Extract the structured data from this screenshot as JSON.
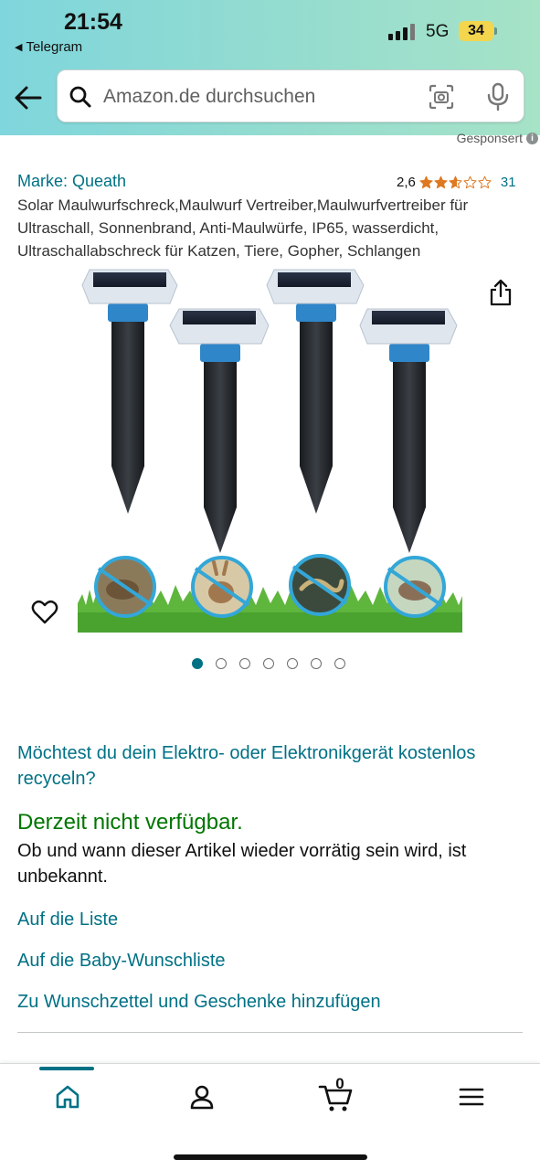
{
  "status_bar": {
    "time": "21:54",
    "back_app": "Telegram",
    "network": "5G",
    "battery": "34"
  },
  "search": {
    "placeholder": "Amazon.de durchsuchen"
  },
  "product": {
    "sponsored_label": "Gesponsert",
    "brand_label": "Marke: Queath",
    "rating_value": "2,6",
    "rating_stars": 2.6,
    "rating_count": "31",
    "title": "Solar Maulwurfschreck,Maulwurf Vertreiber,Maulwurfvertreiber für Ultraschall, Sonnenbrand, Anti-Maulwürfe, IP65, wasserdicht, Ultraschallabschreck für Katzen, Tiere, Gopher, Schlangen",
    "image_count": 7,
    "active_image": 1
  },
  "recycle_link": "Möchtest du dein Elektro- oder Elektronikgerät kostenlos recyceln?",
  "availability": {
    "status": "Derzeit nicht verfügbar.",
    "detail": "Ob und wann dieser Artikel wieder vorrätig sein wird, ist unbekannt."
  },
  "actions": {
    "add_to_list": "Auf die Liste",
    "add_to_baby_registry": "Auf die Baby-Wunschliste",
    "add_to_wishlist": "Zu Wunschzettel und Geschenke hinzufügen"
  },
  "bottom_nav": {
    "cart_count": "0",
    "items": [
      "home-icon",
      "user-icon",
      "cart-icon",
      "menu-icon"
    ]
  },
  "colors": {
    "link": "#007185",
    "available_green": "#007600",
    "star": "#de7921",
    "header_gradient_start": "#7fd6dc",
    "header_gradient_end": "#a6e3c7"
  }
}
